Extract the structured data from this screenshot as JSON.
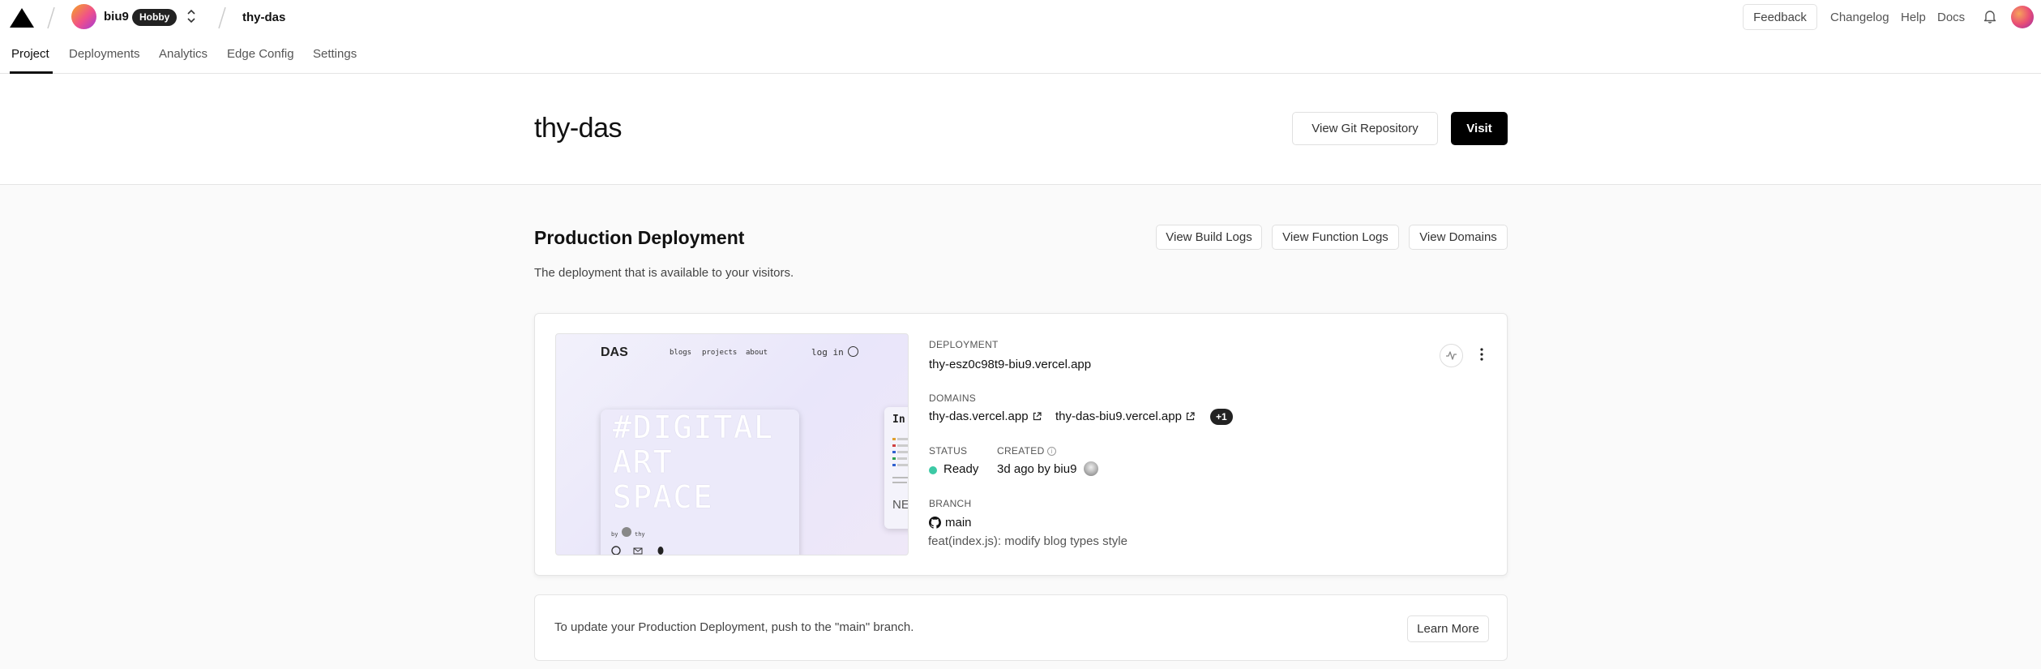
{
  "header": {
    "team_name": "biu9",
    "plan": "Hobby",
    "project": "thy-das",
    "feedback_label": "Feedback",
    "links": [
      "Changelog",
      "Help",
      "Docs"
    ]
  },
  "tabs": [
    "Project",
    "Deployments",
    "Analytics",
    "Edge Config",
    "Settings"
  ],
  "active_tab": "Project",
  "hero": {
    "title": "thy-das",
    "git_button": "View Git Repository",
    "visit_button": "Visit"
  },
  "production": {
    "title": "Production Deployment",
    "subtitle": "The deployment that is available to your visitors.",
    "buttons": [
      "View Build Logs",
      "View Function Logs",
      "View Domains"
    ],
    "preview": {
      "logo": "DAS",
      "nav": [
        "blogs",
        "projects",
        "about"
      ],
      "login": "log in",
      "headline": [
        "#DIGITAL",
        "ART",
        "SPACE"
      ],
      "by": "by",
      "author": "thy",
      "side_title": "In",
      "side_text": "NE"
    },
    "deployment_label": "DEPLOYMENT",
    "deployment_url": "thy-esz0c98t9-biu9.vercel.app",
    "domains_label": "DOMAINS",
    "domains": [
      "thy-das.vercel.app",
      "thy-das-biu9.vercel.app"
    ],
    "extra_domains": "+1",
    "status_label": "STATUS",
    "status_value": "Ready",
    "status_color": "#3cc9a5",
    "created_label": "CREATED",
    "created_value": "3d ago by biu9",
    "branch_label": "BRANCH",
    "branch": "main",
    "commit": "feat(index.js): modify blog types style"
  },
  "hint": {
    "text": "To update your Production Deployment, push to the \"main\" branch.",
    "button": "Learn More"
  },
  "icons": [
    "vercel-logo-icon",
    "chevron-up-down-icon",
    "bell-icon",
    "external-link-icon",
    "info-icon",
    "github-icon",
    "pulse-icon",
    "more-vertical-icon"
  ]
}
